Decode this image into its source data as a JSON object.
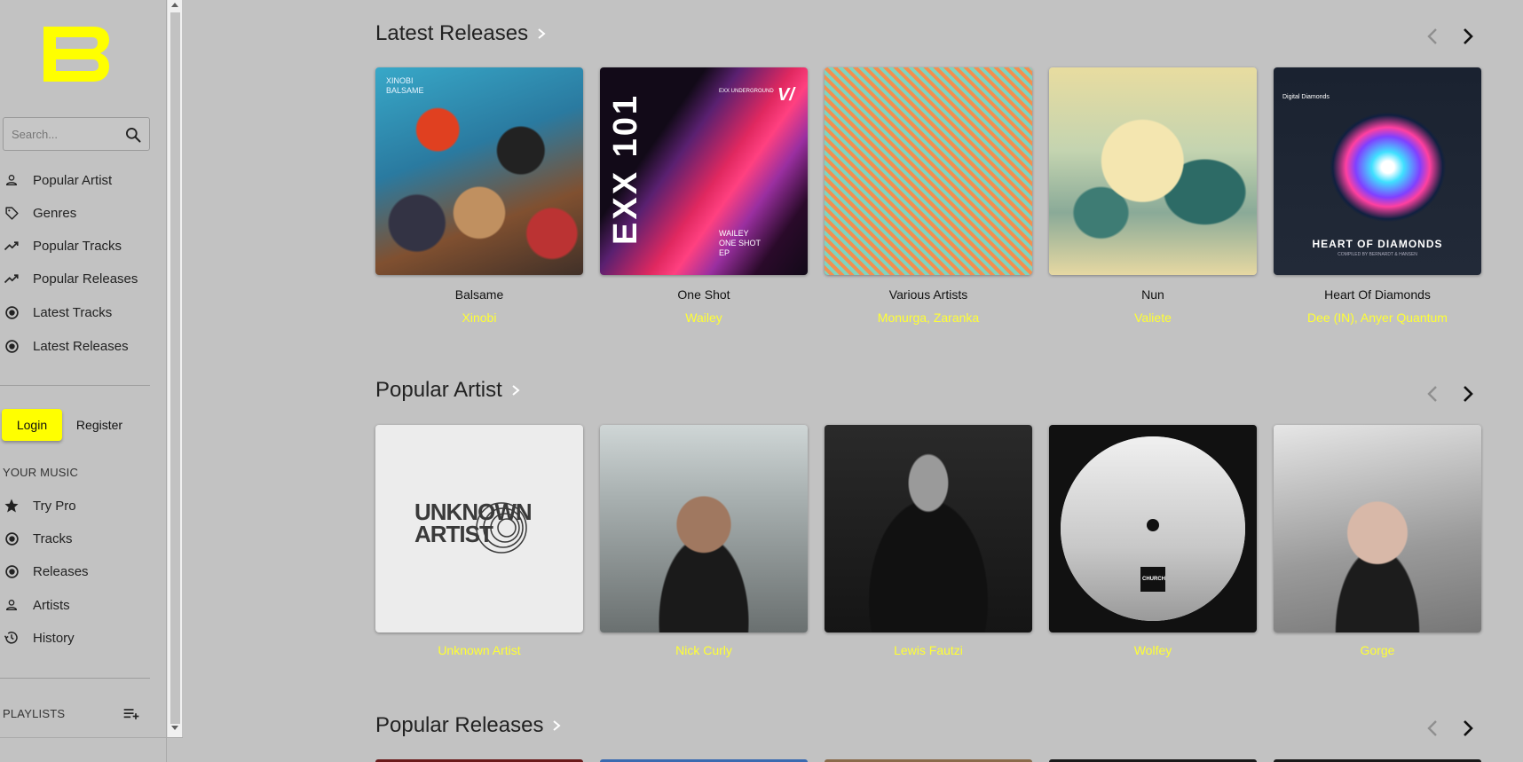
{
  "sidebar": {
    "search_placeholder": "Search...",
    "nav": [
      {
        "label": "Popular Artist",
        "icon": "person-icon"
      },
      {
        "label": "Genres",
        "icon": "tag-icon"
      },
      {
        "label": "Popular Tracks",
        "icon": "trending-up-icon"
      },
      {
        "label": "Popular Releases",
        "icon": "trending-up-icon"
      },
      {
        "label": "Latest Tracks",
        "icon": "radio-button-icon"
      },
      {
        "label": "Latest Releases",
        "icon": "radio-button-icon"
      }
    ],
    "login_label": "Login",
    "register_label": "Register",
    "your_music_label": "YOUR MUSIC",
    "your_music": [
      {
        "label": "Try Pro",
        "icon": "star-icon"
      },
      {
        "label": "Tracks",
        "icon": "radio-button-icon"
      },
      {
        "label": "Releases",
        "icon": "radio-button-icon"
      },
      {
        "label": "Artists",
        "icon": "person-icon"
      },
      {
        "label": "History",
        "icon": "history-icon"
      }
    ],
    "playlists_label": "PLAYLISTS"
  },
  "sections": [
    {
      "title": "Latest Releases",
      "cards": [
        {
          "title": "Balsame",
          "subtitle": "Xinobi"
        },
        {
          "title": "One Shot",
          "subtitle": "Wailey"
        },
        {
          "title": "Various Artists",
          "subtitle": "Monurga, Zaranka"
        },
        {
          "title": "Nun",
          "subtitle": "Valiete"
        },
        {
          "title": "Heart Of Diamonds",
          "subtitle": "Dee (IN), Anyer Quantum"
        }
      ]
    },
    {
      "title": "Popular Artist",
      "cards": [
        {
          "subtitle": "Unknown Artist"
        },
        {
          "subtitle": "Nick Curly"
        },
        {
          "subtitle": "Lewis Fautzi"
        },
        {
          "subtitle": "Wolfey"
        },
        {
          "subtitle": "Gorge"
        }
      ]
    },
    {
      "title": "Popular Releases"
    }
  ],
  "art_text": {
    "balsame": "XINOBI\nBALSAME",
    "oneshot_big": "EXX 101",
    "oneshot_small": "WAILEY\nONE SHOT\nEP",
    "oneshot_label": "EXX UNDERGROUND",
    "diamonds_title": "HEART OF DIAMONDS",
    "diamonds_sub": "COMPILED BY BERNARDT & HANSEN",
    "diamonds_label": "Digital Diamonds",
    "unknown_artist_logo": "UNKNOWN\nARTIST",
    "church_label": "CHURCH"
  },
  "colors": {
    "background": "#c2c2c2",
    "accent": "#ffff00",
    "text": "#222222"
  }
}
